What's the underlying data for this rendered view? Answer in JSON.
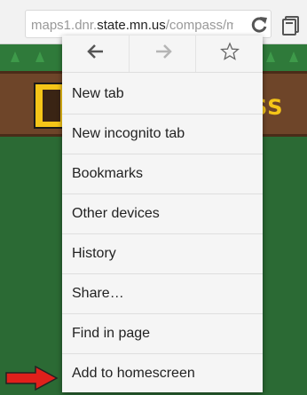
{
  "toolbar": {
    "url_prefix": "maps1.dnr.",
    "url_host": "state.mn.us",
    "url_path": "/compass/mob",
    "reload_icon": "reload-icon",
    "tabs_icon": "tab-switcher-icon"
  },
  "page": {
    "banner_text": "SS"
  },
  "menu": {
    "nav": [
      {
        "icon": "back-arrow-icon",
        "enabled": true
      },
      {
        "icon": "forward-arrow-icon",
        "enabled": false
      },
      {
        "icon": "bookmark-star-icon",
        "enabled": true
      }
    ],
    "items": [
      {
        "label": "New tab"
      },
      {
        "label": "New incognito tab"
      },
      {
        "label": "Bookmarks"
      },
      {
        "label": "Other devices"
      },
      {
        "label": "History"
      },
      {
        "label": "Share…"
      },
      {
        "label": "Find in page"
      },
      {
        "label": "Add to homescreen"
      }
    ]
  },
  "annotation": {
    "arrow_color": "#e0201b",
    "arrow_icon": "red-pointer-arrow-icon"
  }
}
